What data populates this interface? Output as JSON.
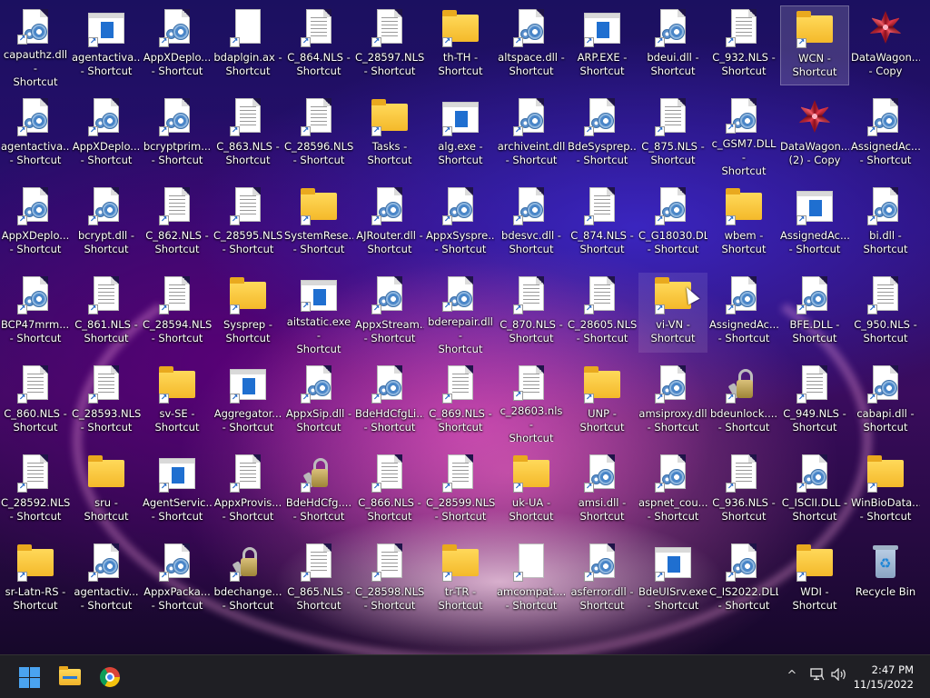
{
  "desktop": {
    "icons": [
      {
        "label": "capauthz.dll -\nShortcut",
        "type": "gears",
        "shortcut": true
      },
      {
        "label": "agentactiva...\n- Shortcut",
        "type": "app",
        "shortcut": true
      },
      {
        "label": "AppXDeplo...\n- Shortcut",
        "type": "gears",
        "shortcut": true
      },
      {
        "label": "bdaplgin.ax -\nShortcut",
        "type": "blank",
        "shortcut": true
      },
      {
        "label": "C_864.NLS -\nShortcut",
        "type": "doc",
        "shortcut": true
      },
      {
        "label": "C_28597.NLS\n- Shortcut",
        "type": "doc",
        "shortcut": true
      },
      {
        "label": "th-TH -\nShortcut",
        "type": "folder",
        "shortcut": true
      },
      {
        "label": "altspace.dll -\nShortcut",
        "type": "gears",
        "shortcut": true
      },
      {
        "label": "ARP.EXE -\nShortcut",
        "type": "app",
        "shortcut": true
      },
      {
        "label": "bdeui.dll -\nShortcut",
        "type": "gears",
        "shortcut": true
      },
      {
        "label": "C_932.NLS -\nShortcut",
        "type": "doc",
        "shortcut": true
      },
      {
        "label": "WCN -\nShortcut",
        "type": "folder",
        "shortcut": true,
        "selected": true
      },
      {
        "label": "DataWagon...\n- Copy",
        "type": "fractal",
        "shortcut": false
      },
      {
        "label": "agentactiva...\n- Shortcut",
        "type": "gears",
        "shortcut": true
      },
      {
        "label": "AppXDeplo...\n- Shortcut",
        "type": "gears",
        "shortcut": true
      },
      {
        "label": "bcryptprim...\n- Shortcut",
        "type": "gears",
        "shortcut": true
      },
      {
        "label": "C_863.NLS -\nShortcut",
        "type": "doc",
        "shortcut": true
      },
      {
        "label": "C_28596.NLS\n- Shortcut",
        "type": "doc",
        "shortcut": true
      },
      {
        "label": "Tasks -\nShortcut",
        "type": "folder",
        "shortcut": true
      },
      {
        "label": "alg.exe -\nShortcut",
        "type": "app",
        "shortcut": true
      },
      {
        "label": "archiveint.dll\n- Shortcut",
        "type": "gears",
        "shortcut": true
      },
      {
        "label": "BdeSysprep....\n- Shortcut",
        "type": "gears",
        "shortcut": true
      },
      {
        "label": "C_875.NLS -\nShortcut",
        "type": "doc",
        "shortcut": true
      },
      {
        "label": "c_GSM7.DLL -\nShortcut",
        "type": "gears",
        "shortcut": true
      },
      {
        "label": "DataWagon....\n(2) - Copy",
        "type": "fractal",
        "shortcut": false
      },
      {
        "label": "AssignedAc...\n- Shortcut",
        "type": "gears",
        "shortcut": true
      },
      {
        "label": "AppXDeplo...\n- Shortcut",
        "type": "gears",
        "shortcut": true
      },
      {
        "label": "bcrypt.dll -\nShortcut",
        "type": "gears",
        "shortcut": true
      },
      {
        "label": "C_862.NLS -\nShortcut",
        "type": "doc",
        "shortcut": true
      },
      {
        "label": "C_28595.NLS\n- Shortcut",
        "type": "doc",
        "shortcut": true
      },
      {
        "label": "SystemRese...\n- Shortcut",
        "type": "folder",
        "shortcut": true
      },
      {
        "label": "AJRouter.dll -\nShortcut",
        "type": "gears",
        "shortcut": true
      },
      {
        "label": "AppxSyspre...\n- Shortcut",
        "type": "gears",
        "shortcut": true
      },
      {
        "label": "bdesvc.dll -\nShortcut",
        "type": "gears",
        "shortcut": true
      },
      {
        "label": "C_874.NLS -\nShortcut",
        "type": "doc",
        "shortcut": true
      },
      {
        "label": "C_G18030.DLL\n- Shortcut",
        "type": "gears",
        "shortcut": true
      },
      {
        "label": "wbem -\nShortcut",
        "type": "folder",
        "shortcut": true
      },
      {
        "label": "AssignedAc...\n- Shortcut",
        "type": "app",
        "shortcut": true
      },
      {
        "label": "bi.dll -\nShortcut",
        "type": "gears",
        "shortcut": true
      },
      {
        "label": "BCP47mrm....\n- Shortcut",
        "type": "gears",
        "shortcut": true
      },
      {
        "label": "C_861.NLS -\nShortcut",
        "type": "doc",
        "shortcut": true
      },
      {
        "label": "C_28594.NLS\n- Shortcut",
        "type": "doc",
        "shortcut": true
      },
      {
        "label": "Sysprep -\nShortcut",
        "type": "folder",
        "shortcut": true
      },
      {
        "label": "aitstatic.exe -\nShortcut",
        "type": "app",
        "shortcut": true
      },
      {
        "label": "AppxStream...\n- Shortcut",
        "type": "gears",
        "shortcut": true
      },
      {
        "label": "bderepair.dll -\nShortcut",
        "type": "gears",
        "shortcut": true
      },
      {
        "label": "C_870.NLS -\nShortcut",
        "type": "doc",
        "shortcut": true
      },
      {
        "label": "C_28605.NLS\n- Shortcut",
        "type": "doc",
        "shortcut": true
      },
      {
        "label": "vi-VN -\nShortcut",
        "type": "folder",
        "shortcut": true,
        "hover": true
      },
      {
        "label": "AssignedAc...\n- Shortcut",
        "type": "gears",
        "shortcut": true
      },
      {
        "label": "BFE.DLL -\nShortcut",
        "type": "gears",
        "shortcut": true
      },
      {
        "label": "C_950.NLS -\nShortcut",
        "type": "doc",
        "shortcut": true
      },
      {
        "label": "C_860.NLS -\nShortcut",
        "type": "doc",
        "shortcut": true
      },
      {
        "label": "C_28593.NLS\n- Shortcut",
        "type": "doc",
        "shortcut": true
      },
      {
        "label": "sv-SE -\nShortcut",
        "type": "folder",
        "shortcut": true
      },
      {
        "label": "Aggregator...\n- Shortcut",
        "type": "app",
        "shortcut": true
      },
      {
        "label": "AppxSip.dll -\nShortcut",
        "type": "gears",
        "shortcut": true
      },
      {
        "label": "BdeHdCfgLi...\n- Shortcut",
        "type": "gears",
        "shortcut": true
      },
      {
        "label": "C_869.NLS -\nShortcut",
        "type": "doc",
        "shortcut": true
      },
      {
        "label": "c_28603.nls -\nShortcut",
        "type": "doc",
        "shortcut": true
      },
      {
        "label": "UNP -\nShortcut",
        "type": "folder",
        "shortcut": true
      },
      {
        "label": "amsiproxy.dll\n- Shortcut",
        "type": "gears",
        "shortcut": true
      },
      {
        "label": "bdeunlock....\n- Shortcut",
        "type": "key",
        "shortcut": true
      },
      {
        "label": "C_949.NLS -\nShortcut",
        "type": "doc",
        "shortcut": true
      },
      {
        "label": "cabapi.dll -\nShortcut",
        "type": "gears",
        "shortcut": true
      },
      {
        "label": "C_28592.NLS\n- Shortcut",
        "type": "doc",
        "shortcut": true
      },
      {
        "label": "sru - Shortcut",
        "type": "folder",
        "shortcut": false
      },
      {
        "label": "AgentServic...\n- Shortcut",
        "type": "app",
        "shortcut": true
      },
      {
        "label": "AppxProvis...\n- Shortcut",
        "type": "doc",
        "shortcut": true
      },
      {
        "label": "BdeHdCfg....\n- Shortcut",
        "type": "key",
        "shortcut": true
      },
      {
        "label": "C_866.NLS -\nShortcut",
        "type": "doc",
        "shortcut": true
      },
      {
        "label": "C_28599.NLS\n- Shortcut",
        "type": "doc",
        "shortcut": true
      },
      {
        "label": "uk-UA -\nShortcut",
        "type": "folder",
        "shortcut": true
      },
      {
        "label": "amsi.dll -\nShortcut",
        "type": "gears",
        "shortcut": true
      },
      {
        "label": "aspnet_cou...\n- Shortcut",
        "type": "gears",
        "shortcut": true
      },
      {
        "label": "C_936.NLS -\nShortcut",
        "type": "doc",
        "shortcut": true
      },
      {
        "label": "C_ISCII.DLL -\nShortcut",
        "type": "gears",
        "shortcut": true
      },
      {
        "label": "WinBioData...\n- Shortcut",
        "type": "folder",
        "shortcut": true
      },
      {
        "label": "sr-Latn-RS -\nShortcut",
        "type": "folder",
        "shortcut": true
      },
      {
        "label": "agentactiv...\n- Shortcut",
        "type": "gears",
        "shortcut": true
      },
      {
        "label": "AppxPacka...\n- Shortcut",
        "type": "gears",
        "shortcut": true
      },
      {
        "label": "bdechange...\n- Shortcut",
        "type": "key",
        "shortcut": true
      },
      {
        "label": "C_865.NLS -\nShortcut",
        "type": "doc",
        "shortcut": true
      },
      {
        "label": "C_28598.NLS\n- Shortcut",
        "type": "doc",
        "shortcut": true
      },
      {
        "label": "tr-TR -\nShortcut",
        "type": "folder",
        "shortcut": true
      },
      {
        "label": "amcompat....\n- Shortcut",
        "type": "blank",
        "shortcut": true
      },
      {
        "label": "asferror.dll -\nShortcut",
        "type": "gears",
        "shortcut": true
      },
      {
        "label": "BdeUISrv.exe\n- Shortcut",
        "type": "app",
        "shortcut": true
      },
      {
        "label": "C_IS2022.DLL\n- Shortcut",
        "type": "gears",
        "shortcut": true
      },
      {
        "label": "WDI -\nShortcut",
        "type": "folder",
        "shortcut": true
      },
      {
        "label": "Recycle Bin",
        "type": "bin",
        "shortcut": false
      }
    ]
  },
  "taskbar": {
    "start": "start-icon",
    "pinned": [
      "file-explorer-icon",
      "chrome-icon"
    ],
    "tray": {
      "chevron": "^",
      "time": "2:47 PM",
      "date": "11/15/2022"
    }
  }
}
